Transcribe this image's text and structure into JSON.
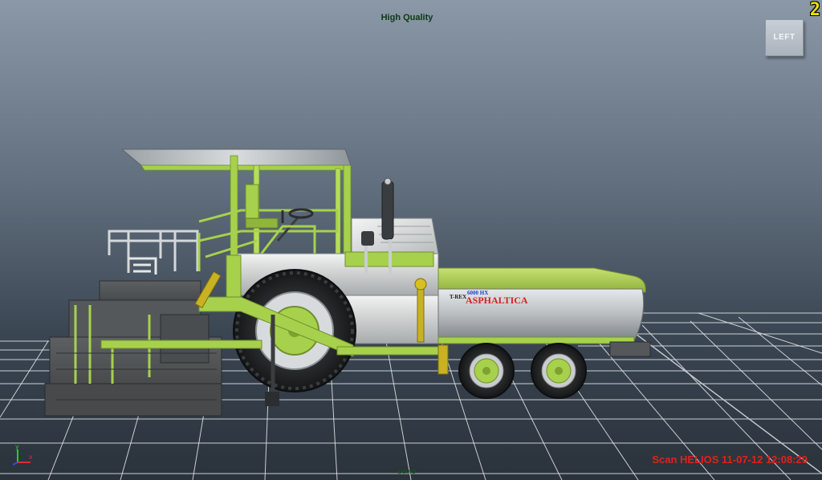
{
  "viewport": {
    "quality_label": "High Quality",
    "panel_number": "2",
    "view_cube_label": "LEFT",
    "camera_name": "persp",
    "scan_label": "Scan HELIOS 11-07-12 12:08:29"
  },
  "axis_gizmo": {
    "y_label": "y",
    "x_label": "x",
    "y_color": "#2ec82e",
    "x_color": "#d83030",
    "z_color": "#3050e0"
  },
  "model": {
    "badge_small": "T-REX",
    "badge_model": "6000 HX",
    "brand_label": "ASPHALTICA",
    "body_color": "#a7d14c",
    "tank_color": "#bfc3c6",
    "brand_color": "#d62020"
  },
  "colors": {
    "background_top": "#8b98a8",
    "background_bottom": "#2a323b",
    "grid_line": "#e6e9ec",
    "quality_text": "#0c3a12",
    "panel_number": "#e8e000",
    "scan_text": "#e0221a"
  }
}
